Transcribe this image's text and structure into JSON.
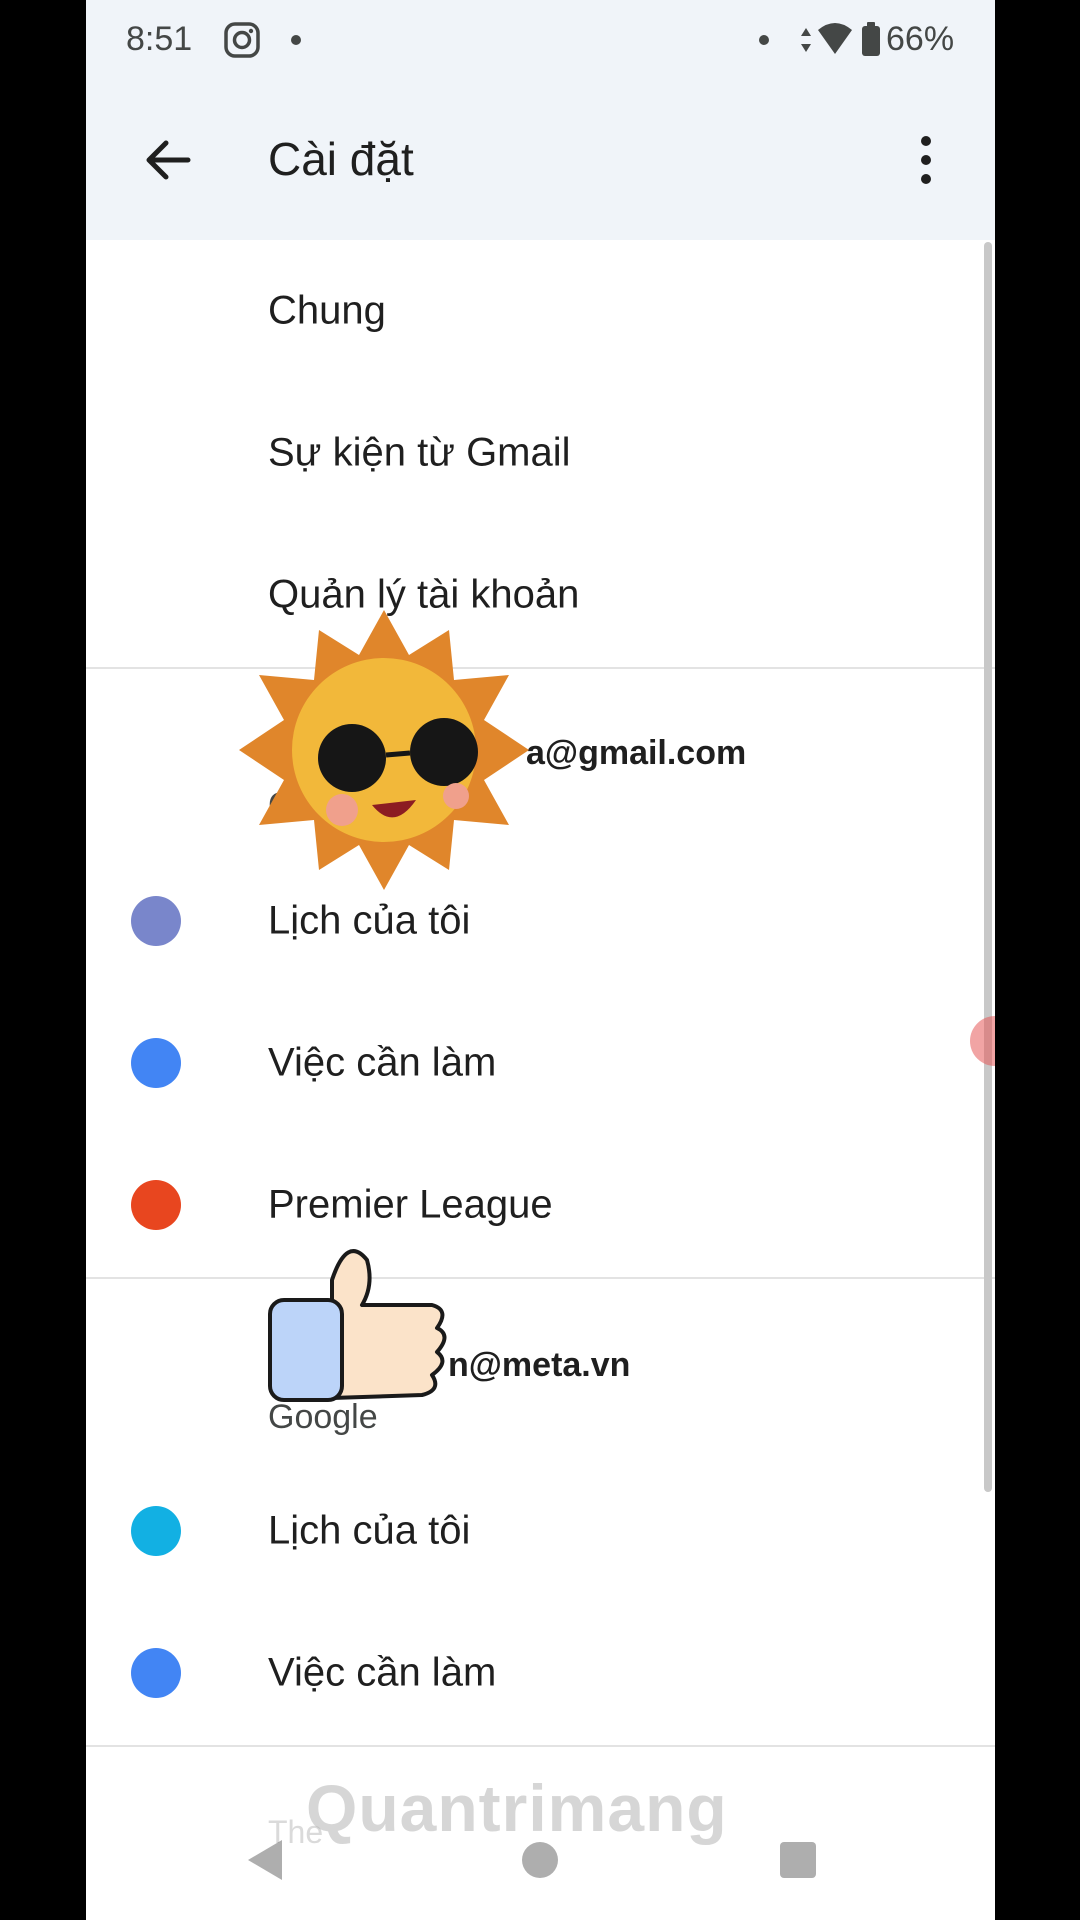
{
  "status_bar": {
    "time": "8:51",
    "battery": "66%",
    "icons": [
      "instagram-icon",
      "notification-dot-icon",
      "data-arrows-icon",
      "wifi-icon",
      "battery-icon"
    ]
  },
  "appbar": {
    "title": "Cài đặt",
    "back_icon": "arrow-back-icon",
    "menu_icon": "more-vert-icon"
  },
  "menu": {
    "general": "Chung",
    "gmail_events": "Sự kiện từ Gmail",
    "manage_accounts": "Quản lý tài khoản"
  },
  "account1": {
    "email": "a@gmail.com",
    "provider": "G",
    "calendars": [
      {
        "label": "Lịch của tôi",
        "color": "#7986cb"
      },
      {
        "label": "Việc cần làm",
        "color": "#4285f4"
      },
      {
        "label": "Premier League",
        "color": "#e8461f"
      }
    ]
  },
  "account2": {
    "email": "n@meta.vn",
    "provider": "Google",
    "calendars": [
      {
        "label": "Lịch của tôi",
        "color": "#12b0e3"
      },
      {
        "label": "Việc cần làm",
        "color": "#4285f4"
      }
    ]
  },
  "footer": {
    "partial_text": "The",
    "watermark": "Quantrimang"
  },
  "colors": {
    "appbar_bg": "#f0f4f9",
    "text_primary": "#1f1f1f",
    "divider": "#e3e3e3"
  }
}
